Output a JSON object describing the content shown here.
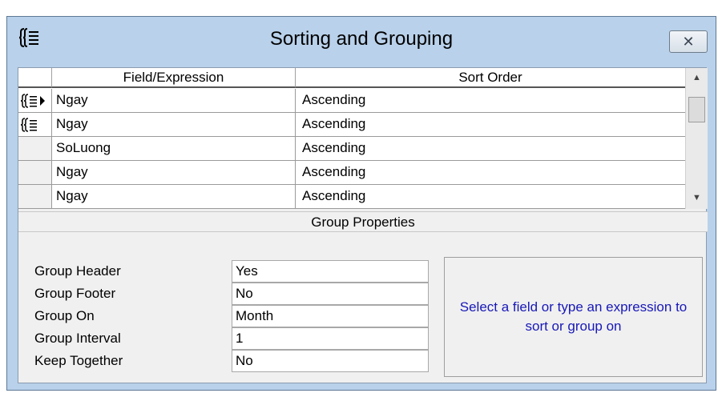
{
  "caption": "Sorting and Grouping dialog partial caption text (unreadable)",
  "window": {
    "title": "Sorting and Grouping",
    "close_glyph": "✕"
  },
  "grid": {
    "columns": [
      "Field/Expression",
      "Sort Order"
    ],
    "rows": [
      {
        "field": "Ngay",
        "sort": "Ascending",
        "icon": "group-current-row-icon"
      },
      {
        "field": "Ngay",
        "sort": "Ascending",
        "icon": "group-icon"
      },
      {
        "field": "SoLuong",
        "sort": "Ascending",
        "icon": ""
      },
      {
        "field": "Ngay",
        "sort": "Ascending",
        "icon": ""
      },
      {
        "field": "Ngay",
        "sort": "Ascending",
        "icon": ""
      }
    ]
  },
  "group_properties": {
    "title": "Group Properties",
    "items": [
      {
        "label": "Group Header",
        "value": "Yes"
      },
      {
        "label": "Group Footer",
        "value": "No"
      },
      {
        "label": "Group On",
        "value": "Month"
      },
      {
        "label": "Group Interval",
        "value": "1"
      },
      {
        "label": "Keep Together",
        "value": "No"
      }
    ],
    "help_text": "Select a field or type an expression to sort or group on"
  }
}
